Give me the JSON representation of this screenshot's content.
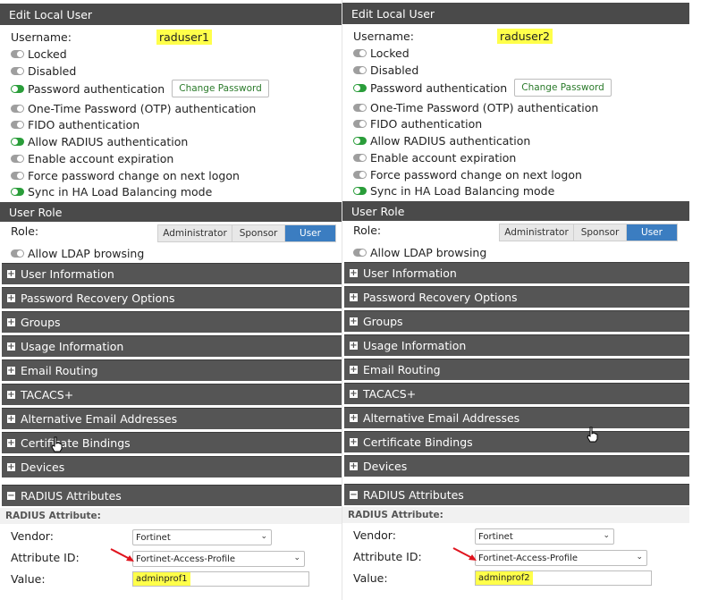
{
  "panels": [
    {
      "title": "Edit Local User",
      "username_label": "Username:",
      "username": "raduser1",
      "toggles": [
        {
          "label": "Locked",
          "on": false
        },
        {
          "label": "Disabled",
          "on": false
        },
        {
          "label": "Password authentication",
          "on": true
        },
        {
          "label": "One-Time Password (OTP) authentication",
          "on": false
        },
        {
          "label": "FIDO authentication",
          "on": false
        },
        {
          "label": "Allow RADIUS authentication",
          "on": true
        },
        {
          "label": "Enable account expiration",
          "on": false
        },
        {
          "label": "Force password change on next logon",
          "on": false
        },
        {
          "label": "Sync in HA Load Balancing mode",
          "on": true
        }
      ],
      "change_password": "Change Password",
      "user_role_title": "User Role",
      "role_label": "Role:",
      "roles": [
        "Administrator",
        "Sponsor",
        "User"
      ],
      "selected_role": "User",
      "ldap_label": "Allow LDAP browsing",
      "sections": [
        "User Information",
        "Password Recovery Options",
        "Groups",
        "Usage Information",
        "Email Routing",
        "TACACS+",
        "Alternative Email Addresses",
        "Certificate Bindings",
        "Devices"
      ],
      "radius_title": "RADIUS Attributes",
      "radius_sub": "RADIUS Attribute:",
      "vendor_label": "Vendor:",
      "vendor_value": "Fortinet",
      "attr_label": "Attribute ID:",
      "attr_value": "Fortinet-Access-Profile",
      "value_label": "Value:",
      "value_value": "adminprof1"
    },
    {
      "title": "Edit Local User",
      "username_label": "Username:",
      "username": "raduser2",
      "toggles": [
        {
          "label": "Locked",
          "on": false
        },
        {
          "label": "Disabled",
          "on": false
        },
        {
          "label": "Password authentication",
          "on": true
        },
        {
          "label": "One-Time Password (OTP) authentication",
          "on": false
        },
        {
          "label": "FIDO authentication",
          "on": false
        },
        {
          "label": "Allow RADIUS authentication",
          "on": true
        },
        {
          "label": "Enable account expiration",
          "on": false
        },
        {
          "label": "Force password change on next logon",
          "on": false
        },
        {
          "label": "Sync in HA Load Balancing mode",
          "on": true
        }
      ],
      "change_password": "Change Password",
      "user_role_title": "User Role",
      "role_label": "Role:",
      "roles": [
        "Administrator",
        "Sponsor",
        "User"
      ],
      "selected_role": "User",
      "ldap_label": "Allow LDAP browsing",
      "sections": [
        "User Information",
        "Password Recovery Options",
        "Groups",
        "Usage Information",
        "Email Routing",
        "TACACS+",
        "Alternative Email Addresses",
        "Certificate Bindings",
        "Devices"
      ],
      "radius_title": "RADIUS Attributes",
      "radius_sub": "RADIUS Attribute:",
      "vendor_label": "Vendor:",
      "vendor_value": "Fortinet",
      "attr_label": "Attribute ID:",
      "attr_value": "Fortinet-Access-Profile",
      "value_label": "Value:",
      "value_value": "adminprof2"
    }
  ],
  "colors": {
    "header_bg": "#4a4a4a",
    "toggle_on": "#2a9d3a",
    "toggle_off": "#9e9e9e",
    "highlight": "#ffff4a",
    "role_selected": "#3b7dc1",
    "arrow": "#e0141e"
  }
}
